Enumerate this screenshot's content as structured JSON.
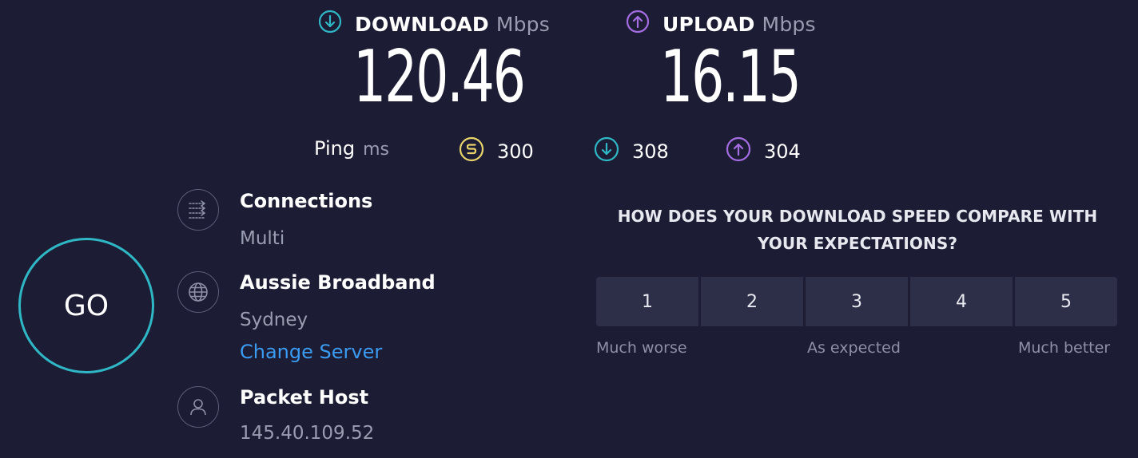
{
  "download": {
    "label": "DOWNLOAD",
    "unit": "Mbps",
    "value": "120.46",
    "icon": "download-arrow-icon",
    "color": "#2fb7c6"
  },
  "upload": {
    "label": "UPLOAD",
    "unit": "Mbps",
    "value": "16.15",
    "icon": "upload-arrow-icon",
    "color": "#a56de2"
  },
  "ping": {
    "label": "Ping",
    "unit": "ms",
    "idle": {
      "value": "300",
      "icon": "idle-ping-icon",
      "color": "#e8d46a"
    },
    "down": {
      "value": "308",
      "icon": "download-ping-icon",
      "color": "#2fb7c6"
    },
    "up": {
      "value": "304",
      "icon": "upload-ping-icon",
      "color": "#a56de2"
    }
  },
  "go": {
    "label": "GO",
    "color": "#2fb7c6"
  },
  "connections": {
    "title": "Connections",
    "value": "Multi",
    "icon": "connections-icon"
  },
  "server": {
    "title": "Aussie Broadband",
    "location": "Sydney",
    "change_label": "Change Server",
    "icon": "globe-icon",
    "link_color": "#3b9bf0"
  },
  "host": {
    "title": "Packet Host",
    "ip": "145.40.109.52",
    "icon": "user-icon"
  },
  "feedback": {
    "question_line1": "HOW DOES YOUR DOWNLOAD SPEED COMPARE WITH",
    "question_line2": "YOUR EXPECTATIONS?",
    "options": [
      "1",
      "2",
      "3",
      "4",
      "5"
    ],
    "low_label": "Much worse",
    "mid_label": "As expected",
    "high_label": "Much better"
  }
}
